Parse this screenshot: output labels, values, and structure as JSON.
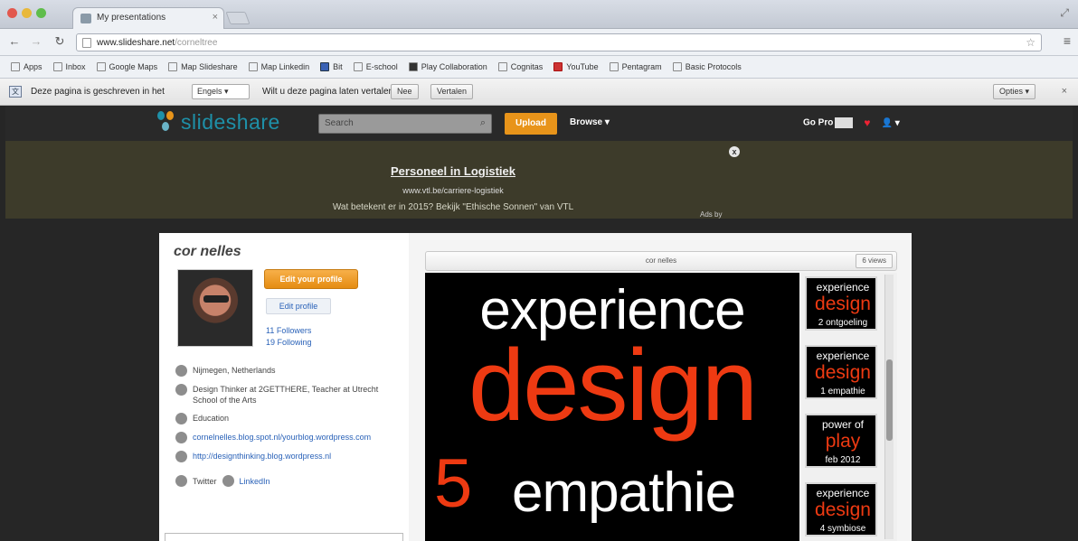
{
  "browser": {
    "tab_title": "My presentations",
    "url_domain": "www.slideshare.net",
    "url_path": "/corneltree",
    "bookmarks": [
      {
        "label": "Apps",
        "icon": "apps-grid-icon"
      },
      {
        "label": "Inbox",
        "icon": "page-icon"
      },
      {
        "label": "Google Maps",
        "icon": "page-icon"
      },
      {
        "label": "Map Slideshare",
        "icon": "page-icon"
      },
      {
        "label": "Map Linkedin",
        "icon": "page-icon"
      },
      {
        "label": "Bit",
        "icon": "page-icon"
      },
      {
        "label": "E-school",
        "icon": "page-icon"
      },
      {
        "label": "Play Collaboration",
        "icon": "page-icon"
      },
      {
        "label": "Cognitas",
        "icon": "page-icon"
      },
      {
        "label": "YouTube",
        "icon": "youtube-icon"
      },
      {
        "label": "Pentagram",
        "icon": "page-icon"
      },
      {
        "label": "Basic Protocols",
        "icon": "page-icon"
      }
    ],
    "translate_bar": {
      "prompt": "Deze pagina is geschreven in het",
      "language": "Engels",
      "question": "Wilt u deze pagina laten vertalen?",
      "yes_label": "Nee",
      "translate_label": "Vertalen",
      "options_label": "Opties"
    }
  },
  "site": {
    "logo_word": "slideshare",
    "search_placeholder": "Search",
    "upload_label": "Upload",
    "browse_label": "Browse",
    "right_label": "Go Pro"
  },
  "ad": {
    "title": "Personeel in Logistiek",
    "url": "www.vtl.be/carriere-logistiek",
    "description": "Wat betekent er in 2015? Bekijk \"Ethische Sonnen\" van VTL",
    "close_glyph": "x",
    "adby": "Ads by"
  },
  "profile": {
    "name": "cor nelles",
    "edit_button": "Edit your profile",
    "view_button": "Edit profile",
    "followers": "11 Followers",
    "following": "19 Following",
    "info": [
      {
        "text": "Nijmegen, Netherlands",
        "icon": "location-icon",
        "link": false
      },
      {
        "text": "Design Thinker at 2GETTHERE, Teacher at Utrecht School of the Arts",
        "icon": "briefcase-icon",
        "link": false
      },
      {
        "text": "Education",
        "icon": "education-icon",
        "link": false
      },
      {
        "text": "cornelnelles.blog.spot.nl/yourblog.wordpress.com",
        "icon": "globe-icon",
        "link": true
      },
      {
        "text": "http://designthinking.blog.wordpress.nl",
        "icon": "link-icon",
        "link": true
      }
    ],
    "social": [
      {
        "text": "Twitter",
        "icon": "twitter-icon"
      },
      {
        "text": "LinkedIn",
        "icon": "linkedin-icon"
      }
    ]
  },
  "viewer": {
    "title": "cor nelles",
    "views": "6 views",
    "slide": {
      "line1": "experience",
      "line2": "design",
      "number": "5",
      "line3": "empathie"
    },
    "thumbnails": [
      {
        "a": "experience",
        "b": "design",
        "c": "2 ontgoeling"
      },
      {
        "a": "experience",
        "b": "design",
        "c": "1 empathie"
      },
      {
        "a": "power of",
        "b": "play",
        "c": "feb 2012"
      },
      {
        "a": "experience",
        "b": "design",
        "c": "4 symbiose"
      }
    ]
  },
  "colors": {
    "accent_orange": "#e8941a",
    "slide_red": "#ee3a12",
    "logo_teal": "#1e90a8"
  }
}
